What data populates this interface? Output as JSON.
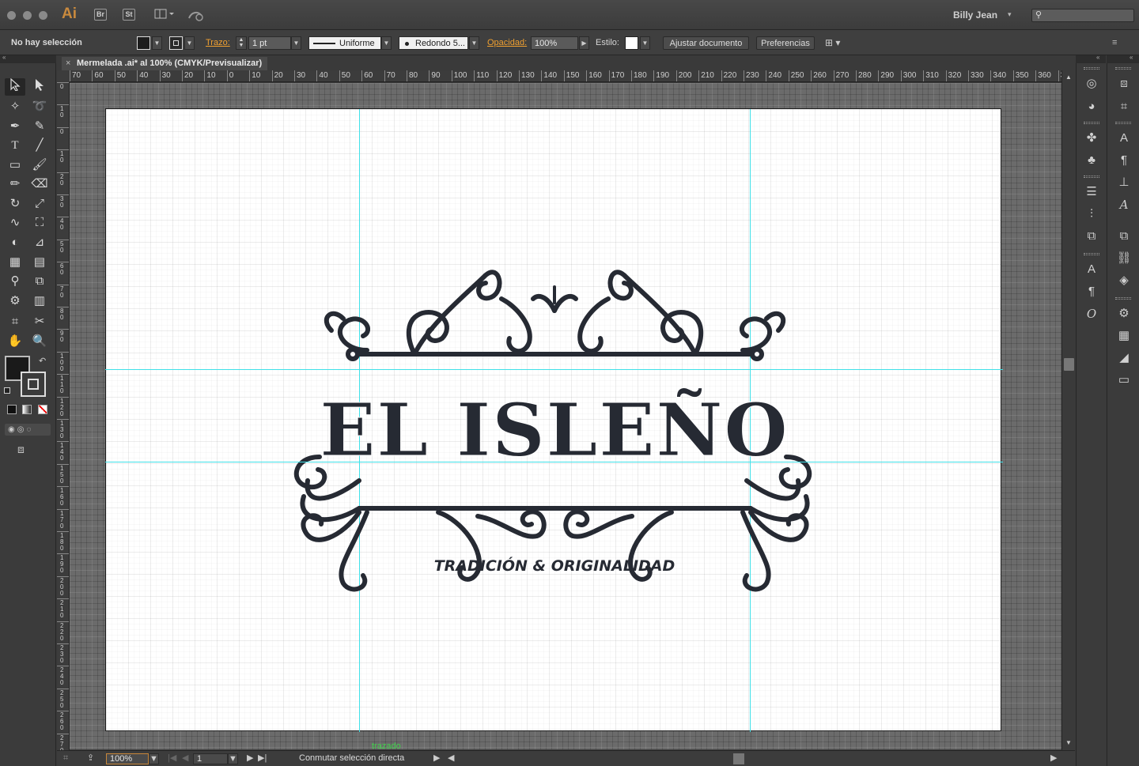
{
  "app": {
    "logo": "Ai",
    "bridge": "Br",
    "stock": "St",
    "user": "Billy Jean",
    "search_placeholder": ""
  },
  "control_bar": {
    "selection_status": "No hay selección",
    "stroke_label": "Trazo:",
    "stroke_weight": "1 pt",
    "stroke_profile": "Uniforme",
    "brush": "Redondo 5...",
    "opacity_label": "Opacidad:",
    "opacity_value": "100%",
    "style_label": "Estilo:",
    "fit_document_button": "Ajustar documento",
    "preferences_button": "Preferencias"
  },
  "document": {
    "tab_title": "Mermelada .ai* al 100% (CMYK/Previsualizar)",
    "close_glyph": "×"
  },
  "ruler": {
    "h_labels": [
      "70",
      "60",
      "50",
      "40",
      "30",
      "20",
      "10",
      "0",
      "10",
      "20",
      "30",
      "40",
      "50",
      "60",
      "70",
      "80",
      "90",
      "100",
      "110",
      "120",
      "130",
      "140",
      "150",
      "160",
      "170",
      "180",
      "190",
      "200",
      "210",
      "220",
      "230",
      "240",
      "250",
      "260",
      "270",
      "280",
      "290",
      "300",
      "310",
      "320",
      "330",
      "340",
      "350",
      "360",
      "3"
    ],
    "v_labels": [
      "0",
      "1 0",
      "0",
      "1 0",
      "2 0",
      "3 0",
      "4 0",
      "5 0",
      "6 0",
      "7 0",
      "8 0",
      "9 0",
      "1 0 0",
      "1 1 0",
      "1 2 0",
      "1 3 0",
      "1 4 0",
      "1 5 0",
      "1 6 0",
      "1 7 0",
      "1 8 0",
      "1 9 0",
      "2 0 0",
      "2 1 0",
      "2 2 0",
      "2 3 0",
      "2 4 0",
      "2 5 0",
      "2 6 0",
      "2 7 0"
    ]
  },
  "artboard": {
    "logo_title": "EL ISLEÑO",
    "logo_tagline": "TRADICIÓN & ORIGINALIDAD",
    "smart_guide_hint": "trazado"
  },
  "status_bar": {
    "zoom": "100%",
    "artboard_number": "1",
    "status_text": "Conmutar selección directa"
  },
  "colors": {
    "guide": "#3fe0e8",
    "accent_orange": "#f0a030",
    "ink": "#262a33",
    "hint_green": "#3fd24a"
  }
}
